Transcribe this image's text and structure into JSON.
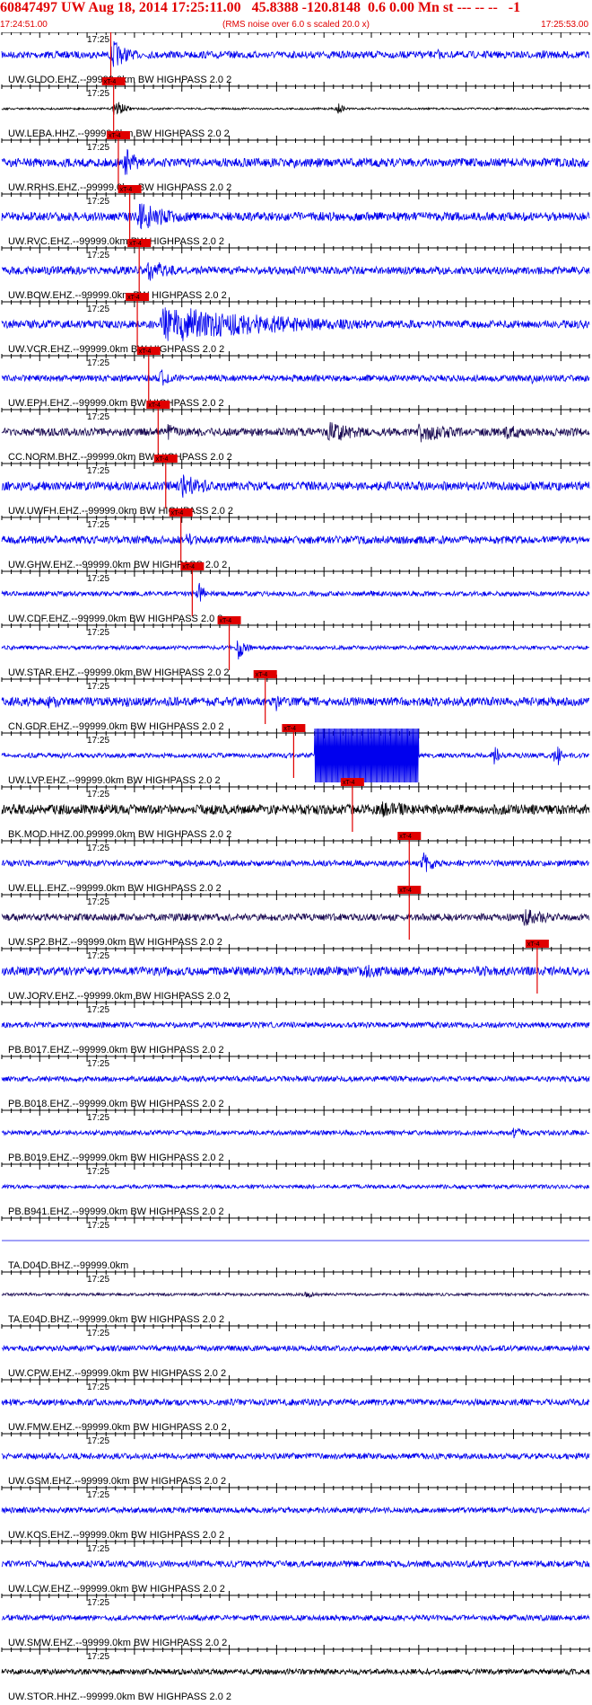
{
  "header": {
    "title": "60847497 UW Aug 18, 2014 17:25:11.00   45.8388 -120.8148  0.6 0.00 Mn st --- -- --   -1",
    "start_time": "17:24:51.00",
    "end_time": "17:25:53.00",
    "rms_note": "(RMS noise over 6.0 s scaled 20.0 x)"
  },
  "pick_label": "xT-4",
  "time_label": "17:25",
  "colors": {
    "title": "#e00000",
    "trace": "#0000ee",
    "trace_dark": "#1a0a52",
    "trace_black": "#000000",
    "pick": "#e00000",
    "axis": "#000000"
  },
  "chart_data": {
    "type": "line",
    "title": "60847497 UW Aug 18, 2014 17:25:11.00   45.8388 -120.8148  0.6 0.00 Mn st --- -- --   -1",
    "x_range": [
      "17:24:51.00",
      "17:25:53.00"
    ],
    "series": [
      {
        "label": "UW.GLDO.EHZ.--99999.0km BW  HIGHPASS  2.0  2",
        "color": "trace",
        "pick_s": 11.5,
        "amp": 0.18,
        "bursts": [
          [
            11.7,
            0.8,
            1.8
          ],
          [
            46.0,
            0.3,
            0.9
          ],
          [
            57.0,
            0.3,
            0.8
          ]
        ]
      },
      {
        "label": "UW.LEBA.HHZ.--99999.0km BW  HIGHPASS  2.0  2",
        "color": "trace_black",
        "pick_s": 11.8,
        "amp": 0.05,
        "bursts": [
          [
            12.0,
            0.5,
            1.0
          ],
          [
            35.5,
            0.3,
            0.7
          ]
        ]
      },
      {
        "label": "UW.RRHS.EHZ.--99999.0km BW  HIGHPASS  2.0  2",
        "color": "trace",
        "pick_s": 12.3,
        "amp": 0.22,
        "bursts": [
          [
            13.0,
            0.8,
            1.5
          ],
          [
            31.0,
            0.5,
            1.0
          ],
          [
            53.5,
            0.3,
            0.8
          ]
        ]
      },
      {
        "label": "UW.RVC.EHZ.--99999.0km BW  HIGHPASS  2.0  2",
        "color": "trace",
        "pick_s": 13.5,
        "amp": 0.22,
        "bursts": [
          [
            14.5,
            0.8,
            4.0
          ]
        ]
      },
      {
        "label": "UW.BOW.EHZ.--99999.0km BW  HIGHPASS  2.0  2",
        "color": "trace",
        "pick_s": 14.5,
        "amp": 0.2,
        "bursts": [
          [
            15.5,
            0.6,
            3.0
          ]
        ]
      },
      {
        "label": "UW.VCR.EHZ.--99999.0km BW  HIGHPASS  2.0  2",
        "color": "trace",
        "pick_s": 14.3,
        "amp": 0.2,
        "bursts": [
          [
            17.0,
            1.0,
            14.0
          ]
        ]
      },
      {
        "label": "UW.EPH.EHZ.--99999.0km BW  HIGHPASS  2.0  2",
        "color": "trace",
        "pick_s": 15.5,
        "amp": 0.16,
        "bursts": [
          [
            16.8,
            0.5,
            1.2
          ],
          [
            56.0,
            0.45,
            0.5
          ]
        ]
      },
      {
        "label": "CC.NORM.BHZ.--99999.0km BW  HIGHPASS  2.0  2",
        "color": "trace_dark",
        "pick_s": 16.5,
        "amp": 0.2,
        "bursts": [
          [
            17.5,
            0.5,
            2.0
          ],
          [
            34.5,
            0.6,
            4.0
          ],
          [
            44.0,
            0.55,
            5.0
          ],
          [
            53.0,
            0.45,
            3.0
          ]
        ]
      },
      {
        "label": "UW.UWFH.EHZ.--99999.0km BW  HIGHPASS  2.0  2",
        "color": "trace",
        "pick_s": 17.3,
        "amp": 0.22,
        "bursts": [
          [
            19.0,
            0.7,
            3.0
          ]
        ]
      },
      {
        "label": "UW.GHW.EHZ.--99999.0km BW  HIGHPASS  2.0  2",
        "color": "trace",
        "pick_s": 18.9,
        "amp": 0.2,
        "bursts": [
          [
            19.5,
            0.4,
            2.0
          ]
        ]
      },
      {
        "label": "UW.CDF.EHZ.--99999.0km BW  HIGHPASS  2.0  2",
        "color": "trace",
        "pick_s": 20.1,
        "amp": 0.12,
        "bursts": [
          [
            20.8,
            0.6,
            0.8
          ],
          [
            39.0,
            0.2,
            0.6
          ]
        ]
      },
      {
        "label": "UW.STAR.EHZ.--99999.0km BW  HIGHPASS  2.0  2",
        "color": "trace",
        "pick_s": 24.0,
        "amp": 0.1,
        "bursts": [
          [
            25.0,
            0.7,
            0.8
          ]
        ]
      },
      {
        "label": "CN.GDR.EHZ.--99999.0km BW  HIGHPASS  2.0  2",
        "color": "trace",
        "pick_s": 27.8,
        "amp": 0.22,
        "bursts": [
          [
            5.0,
            0.45,
            1.8
          ],
          [
            13.0,
            0.35,
            1.2
          ],
          [
            29.0,
            0.6,
            0.5
          ]
        ]
      },
      {
        "label": "UW.LVP.EHZ.--99999.0km BW  HIGHPASS  2.0  2",
        "color": "trace",
        "pick_s": 30.8,
        "amp": 0.12,
        "clip": [
          33.0,
          44.0
        ],
        "bursts": [
          [
            52.0,
            0.7,
            0.6
          ],
          [
            58.5,
            0.8,
            0.5
          ]
        ]
      },
      {
        "label": "BK.MOD.HHZ.00.99999.0km BW  HIGHPASS  2.0  2",
        "color": "trace_black",
        "pick_s": 37.0,
        "amp": 0.25,
        "bursts": [
          [
            40.0,
            0.45,
            6.0
          ]
        ]
      },
      {
        "label": "UW.ELL.EHZ.--99999.0km BW  HIGHPASS  2.0  2",
        "color": "trace",
        "pick_s": 43.0,
        "amp": 0.15,
        "bursts": [
          [
            44.5,
            0.6,
            1.5
          ]
        ]
      },
      {
        "label": "UW.SP2.BHZ.--99999.0km BW  HIGHPASS  2.0  2",
        "color": "trace_dark",
        "pick_s": 43.0,
        "amp": 0.18,
        "bursts": [
          [
            55.0,
            0.5,
            4.0
          ]
        ]
      },
      {
        "label": "UW.JORV.EHZ.--99999.0km BW  HIGHPASS  2.0  2",
        "color": "trace",
        "pick_s": 56.5,
        "amp": 0.22,
        "bursts": [
          [
            38.0,
            0.4,
            4.0
          ],
          [
            50.0,
            0.35,
            3.0
          ]
        ]
      },
      {
        "label": "PB.B017.EHZ.--99999.0km BW  HIGHPASS  2.0  2",
        "color": "trace",
        "amp": 0.14,
        "bursts": []
      },
      {
        "label": "PB.B018.EHZ.--99999.0km BW  HIGHPASS  2.0  2",
        "color": "trace",
        "amp": 0.14,
        "bursts": []
      },
      {
        "label": "PB.B019.EHZ.--99999.0km BW  HIGHPASS  2.0  2",
        "color": "trace",
        "amp": 0.12,
        "bursts": [
          [
            54.0,
            0.3,
            1.5
          ]
        ]
      },
      {
        "label": "PB.B941.EHZ.--99999.0km BW  HIGHPASS  2.0  2",
        "color": "trace",
        "amp": 0.1,
        "bursts": []
      },
      {
        "label": "TA.D04D.BHZ.--99999.0km",
        "color": "trace",
        "amp": 0.0,
        "bursts": []
      },
      {
        "label": "TA.E04D.BHZ.--99999.0km BW  HIGHPASS  2.0  2",
        "color": "trace_dark",
        "amp": 0.07,
        "bursts": [
          [
            32.0,
            0.2,
            1.5
          ]
        ]
      },
      {
        "label": "UW.CPW.EHZ.--99999.0km BW  HIGHPASS  2.0  2",
        "color": "trace",
        "amp": 0.14,
        "bursts": []
      },
      {
        "label": "UW.FMW.EHZ.--99999.0km BW  HIGHPASS  2.0  2",
        "color": "trace",
        "amp": 0.16,
        "bursts": []
      },
      {
        "label": "UW.GSM.EHZ.--99999.0km BW  HIGHPASS  2.0  2",
        "color": "trace",
        "amp": 0.15,
        "bursts": []
      },
      {
        "label": "UW.KOS.EHZ.--99999.0km BW  HIGHPASS  2.0  2",
        "color": "trace",
        "amp": 0.14,
        "bursts": []
      },
      {
        "label": "UW.LCW.EHZ.--99999.0km BW  HIGHPASS  2.0  2",
        "color": "trace",
        "amp": 0.16,
        "bursts": []
      },
      {
        "label": "UW.SMW.EHZ.--99999.0km BW  HIGHPASS  2.0  2",
        "color": "trace",
        "amp": 0.14,
        "bursts": []
      },
      {
        "label": "UW.STOR.HHZ.--99999.0km BW  HIGHPASS  2.0  2",
        "color": "trace_black",
        "amp": 0.14,
        "bursts": []
      }
    ]
  }
}
